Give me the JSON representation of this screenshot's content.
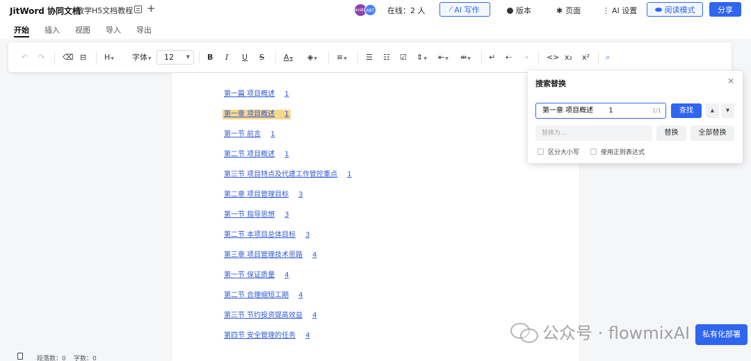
{
  "header": {
    "app_name": "JitWord 协同文档",
    "doc_title": "教学H5文档教程",
    "avatars": [
      "avatar",
      "ABT"
    ],
    "online": "在线：2 人",
    "ai_write": "AI 写作",
    "version": "版本",
    "page": "页面",
    "ai_settings": "AI 设置",
    "read_mode": "阅读模式",
    "share": "分享"
  },
  "tabs": [
    "开始",
    "插入",
    "视图",
    "导入",
    "导出"
  ],
  "toolbar": {
    "undo": "↶",
    "redo": "↷",
    "heading": "H",
    "font_family": "字体",
    "font_size": "12",
    "bold": "B",
    "italic": "I",
    "underline": "U",
    "strike": "S",
    "code": "<>",
    "subscript": "x₂",
    "superscript": "x²"
  },
  "document": {
    "toc": [
      {
        "text": "第一篇 项目概述",
        "page": "1"
      },
      {
        "text": "第一章 项目概述",
        "page": "1"
      },
      {
        "text": "第一节 前言",
        "page": "1"
      },
      {
        "text": "第二节 项目概述",
        "page": "1"
      },
      {
        "text": "第三节 项目特点及代建工作管控重点",
        "page": "1"
      },
      {
        "text": "第二章 项目管理目标",
        "page": "3"
      },
      {
        "text": "第一节 指导思想",
        "page": "3"
      },
      {
        "text": "第二节 本项目总体目标",
        "page": "3"
      },
      {
        "text": "第三章 项目管理技术思路",
        "page": "4"
      },
      {
        "text": "第一节 保证质量",
        "page": "4"
      },
      {
        "text": "第二节 合理缩短工期",
        "page": "4"
      },
      {
        "text": "第三节 节约投资提高效益",
        "page": "4"
      },
      {
        "text": "第四节 安全管理的任务",
        "page": "4"
      }
    ]
  },
  "search_panel": {
    "title": "搜索替换",
    "query": "第一章 项目概述       1",
    "count": "1/1",
    "find": "查找",
    "replace_placeholder": "替换为...",
    "replace": "替换",
    "replace_all": "全部替换",
    "case_sensitive": "区分大小写",
    "regex": "使用正则表达式"
  },
  "watermark": "公众号 · flowmixAI",
  "deploy": "私有化部署",
  "status": {
    "paragraphs": "段落数：0",
    "words": "字数：0"
  }
}
